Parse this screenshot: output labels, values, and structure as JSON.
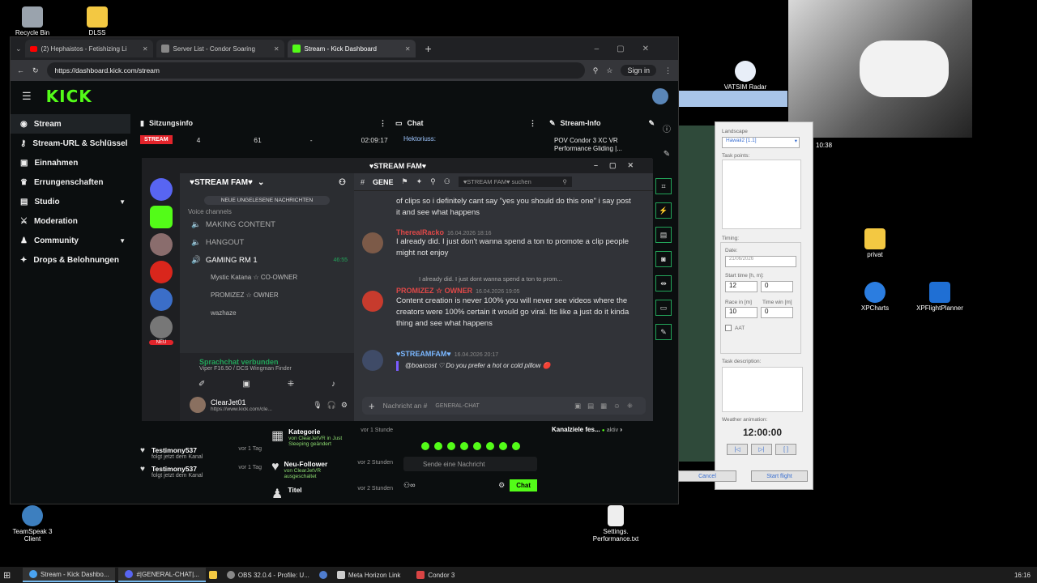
{
  "desktop": {
    "icons": [
      {
        "label": "Recycle Bin"
      },
      {
        "label": "DLSS"
      },
      {
        "label": "privat"
      },
      {
        "label": "XPCharts"
      },
      {
        "label": "XPFlightPlanner"
      },
      {
        "label": "TeamSpeak 3 Client"
      },
      {
        "label": "Settings. Performance.txt"
      },
      {
        "label": "VATSIM Radar"
      }
    ]
  },
  "browser": {
    "tabs": [
      {
        "label": "(2) Hephaistos - Fetishizing Li"
      },
      {
        "label": "Server List - Condor Soaring"
      },
      {
        "label": "Stream - Kick Dashboard"
      }
    ],
    "url": "https://dashboard.kick.com/stream",
    "signin": "Sign in"
  },
  "kick": {
    "logo": "KICK",
    "nav": [
      {
        "label": "Stream"
      },
      {
        "label": "Stream-URL & Schlüssel"
      },
      {
        "label": "Einnahmen"
      },
      {
        "label": "Errungenschaften"
      },
      {
        "label": "Studio"
      },
      {
        "label": "Moderation"
      },
      {
        "label": "Community"
      },
      {
        "label": "Drops & Belohnungen"
      }
    ],
    "session": {
      "title": "Sitzungsinfo",
      "badge": "STREAM",
      "viewers": "4",
      "followers": "61",
      "dash": "-",
      "time": "02:09:17"
    },
    "chat_title": "Chat",
    "chat_user": "Hektoriuss:",
    "stream_info": {
      "title": "Stream-Info",
      "text": "POV Condor 3 XC VR Performance Gliding |..."
    },
    "activity": [
      {
        "name": "Testimony537",
        "time": "vor 1 Tag",
        "action": "folgt jetzt dem Kanal"
      },
      {
        "name": "Testimony537",
        "time": "vor 1 Tag",
        "action": "folgt jetzt dem Kanal"
      }
    ],
    "events": [
      {
        "label": "Kategorie",
        "time": "vor 1 Stunde",
        "detail": "von ClearJetVR in Just Sleeping geändert"
      },
      {
        "label": "Neu-Follower",
        "time": "vor 2 Stunden",
        "detail": "von ClearJetVR ausgeschaltet"
      },
      {
        "label": "Titel",
        "time": "vor 2 Stunden",
        "detail": ""
      }
    ],
    "chat_input": "Sende eine Nachricht",
    "chat_button": "Chat",
    "channel_goals": "Kanalziele fes...",
    "active": "aktiv"
  },
  "discord": {
    "title": "♥STREAM FAM♥",
    "server_name": "♥STREAM FAM♥",
    "unread": "NEUE UNGELESENE NACHRICHTEN",
    "voice_header": "Voice channels",
    "channels": [
      {
        "label": "MAKING CONTENT"
      },
      {
        "label": "HANGOUT"
      },
      {
        "label": "GAMING RM 1",
        "time": "46:55"
      }
    ],
    "voice_users": [
      "Mystic Katana ☆ CO-OWNER",
      "PROMIZEZ ☆ OWNER",
      "wazhaze"
    ],
    "voice_connected": "Sprachchat verbunden",
    "voice_sub": "Viper F16.50 / DCS Wingman Finder",
    "user": {
      "name": "ClearJet01",
      "status": "https://www.kick.com/cle..."
    },
    "new_badge": "NEU",
    "search": "♥STREAM FAM♥ suchen",
    "channel_tab": "GENE",
    "messages": [
      {
        "name": "",
        "time": "",
        "text": "of clips so i definitely cant say \"yes you should do this one\" i say post it and see what happens",
        "color": "#e3e3e3"
      },
      {
        "name": "TherealRacko",
        "time": "16.04.2026 18:16",
        "text": "I already did. I just don't wanna spend a ton to promote a clip people might not enjoy",
        "color": "#e04848"
      },
      {
        "name": "PROMIZEZ ☆ OWNER",
        "time": "16.04.2026 19:05",
        "text": "Content creation is never 100% you will never see videos where the creators were 100% certain it would go viral. Its like a just do it kinda thing and see what happens",
        "color": "#e04848"
      },
      {
        "name": "♥STREAMFAM♥",
        "time": "16.04.2026 20:17",
        "text": "@boarcost ♡  Do you prefer a hot or cold pillow 🔴",
        "color": "#7ab7ff"
      }
    ],
    "reply_preview": "I already did. I just dont wanna spend a ton to prom...",
    "input_placeholder": "Nachricht an #",
    "input_channel": "GENERAL-CHAT"
  },
  "condor": {
    "landscape_label": "Landscape",
    "landscape_value": "Hawaii2 [1.1]",
    "task_points": "Task points:",
    "timing": "Timing:",
    "date_label": "Date:",
    "date_value": "21/06/2026",
    "start_time_label": "Start time [h, m]:",
    "start_h": "12",
    "start_m": "0",
    "race_label": "Race in [m]",
    "race_value": "10",
    "time_win_label": "Time win [m]",
    "time_win_value": "0",
    "aat": "AAT",
    "task_desc": "Task description:",
    "weather": "Weather animation:",
    "clock": "12:00:00",
    "cancel": "Cancel",
    "start": "Start flight",
    "side_time": "10:38"
  },
  "taskbar": {
    "items": [
      {
        "label": "Stream - Kick Dashbo..."
      },
      {
        "label": "#|GENERAL-CHAT|..."
      },
      {
        "label": "OBS 32.0.4 - Profile: U..."
      },
      {
        "label": "Meta Horizon Link"
      },
      {
        "label": "Condor 3"
      }
    ],
    "clock": "16:16"
  }
}
